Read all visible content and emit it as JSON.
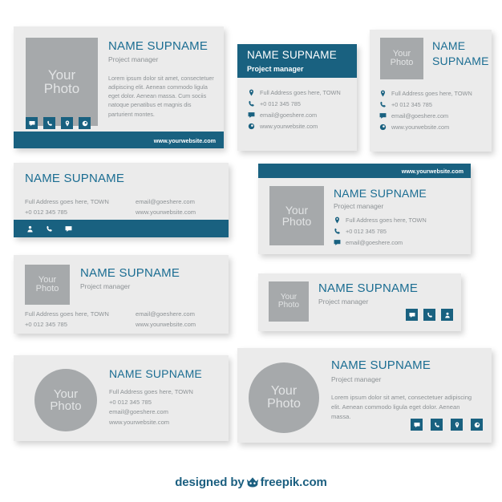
{
  "palette": {
    "teal": "#196180",
    "name_blue": "#1b6d92",
    "card_bg": "#ebebeb",
    "photo_gray": "#a6a9ab",
    "text_gray": "#8d9295",
    "page_bg": "#ffffff"
  },
  "common": {
    "name": "NAME SUPNAME",
    "role": "Project manager",
    "photo_line1": "Your",
    "photo_line2": "Photo",
    "address": "Full Address goes here, TOWN",
    "phone": "+0 012 345 785",
    "email": "email@goeshere.com",
    "website": "www.yourwebsite.com",
    "lorem_long": "Lorem ipsum dolor sit amet, consectetuer adipiscing elit. Aenean commodo ligula eget dolor. Aenean massa. Cum sociis natoque penatibus et magnis dis parturient montes.",
    "lorem_short": "Lorem ipsum dolor sit amet, consectetuer adipiscing elit. Aenean commodo ligula eget dolor. Aenean massa."
  },
  "cards": {
    "card1": {
      "name": "NAME SUPNAME",
      "role": "Project manager",
      "photo_line1": "Your",
      "photo_line2": "Photo",
      "body": "Lorem ipsum dolor sit amet, consectetuer adipiscing elit. Aenean commodo ligula eget dolor. Aenean massa. Cum sociis natoque penatibus et magnis dis parturient montes.",
      "website": "www.yourwebsite.com",
      "icons": [
        "chat-icon",
        "phone-icon",
        "location-pin-icon",
        "globe-icon"
      ]
    },
    "card2": {
      "name": "NAME SUPNAME",
      "role": "Project manager",
      "address": "Full Address goes here, TOWN",
      "phone": "+0 012 345 785",
      "email": "email@goeshere.com",
      "website": "www.yourwebsite.com",
      "icons": [
        "location-pin-icon",
        "phone-icon",
        "chat-icon",
        "globe-icon"
      ]
    },
    "card3": {
      "name_line1": "NAME",
      "name_line2": "SUPNAME",
      "photo_line1": "Your",
      "photo_line2": "Photo",
      "address": "Full Address goes here, TOWN",
      "phone": "+0 012 345 785",
      "email": "email@goeshere.com",
      "website": "www.yourwebsite.com",
      "icons": [
        "location-pin-icon",
        "phone-icon",
        "chat-icon",
        "globe-icon"
      ]
    },
    "card4": {
      "name": "NAME SUPNAME",
      "address": "Full Address goes here, TOWN",
      "phone": "+0 012 345 785",
      "email": "email@goeshere.com",
      "website": "www.yourwebsite.com",
      "icons": [
        "user-icon",
        "phone-icon",
        "chat-icon"
      ]
    },
    "card5": {
      "website": "www.yourwebsite.com",
      "name": "NAME SUPNAME",
      "role": "Project manager",
      "photo_line1": "Your",
      "photo_line2": "Photo",
      "address": "Full Address goes here, TOWN",
      "phone": "+0 012 345 785",
      "email": "email@goeshere.com",
      "icons": [
        "location-pin-icon",
        "phone-icon",
        "chat-icon"
      ]
    },
    "card6": {
      "name": "NAME SUPNAME",
      "role": "Project manager",
      "photo_line1": "Your",
      "photo_line2": "Photo",
      "address": "Full Address goes here, TOWN",
      "phone": "+0 012 345 785",
      "email": "email@goeshere.com",
      "website": "www.yourwebsite.com"
    },
    "card7": {
      "name": "NAME SUPNAME",
      "role": "Project manager",
      "photo_line1": "Your",
      "photo_line2": "Photo",
      "icons": [
        "chat-icon",
        "phone-icon",
        "user-icon"
      ]
    },
    "card8": {
      "name": "NAME SUPNAME",
      "photo_line1": "Your",
      "photo_line2": "Photo",
      "address": "Full Address goes here, TOWN",
      "phone": "+0 012 345 785",
      "email": "email@goeshere.com",
      "website": "www.yourwebsite.com"
    },
    "card9": {
      "name": "NAME SUPNAME",
      "role": "Project manager",
      "photo_line1": "Your",
      "photo_line2": "Photo",
      "body": "Lorem ipsum dolor sit amet, consectetuer adipiscing elit. Aenean commodo ligula eget dolor. Aenean massa.",
      "icons": [
        "chat-icon",
        "phone-icon",
        "location-pin-icon",
        "globe-icon"
      ]
    }
  },
  "footer": {
    "prefix": "designed by",
    "suffix": "freepik.com",
    "logo": "freepik-crown-icon"
  }
}
